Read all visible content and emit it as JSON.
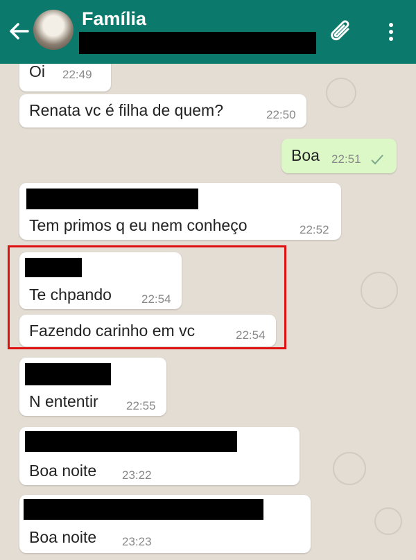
{
  "header": {
    "title": "Família"
  },
  "messages": [
    {
      "text": "Oi",
      "time": "22:49"
    },
    {
      "text": "Renata vc é filha de quem?",
      "time": "22:50"
    },
    {
      "text": "Boa",
      "time": "22:51"
    },
    {
      "text": "Tem primos q eu nem conheço",
      "time": "22:52"
    },
    {
      "text": "Te chpando",
      "time": "22:54"
    },
    {
      "text": "Fazendo carinho em vc",
      "time": "22:54"
    },
    {
      "text": "N ententir",
      "time": "22:55"
    },
    {
      "text": "Boa noite",
      "time": "23:22"
    },
    {
      "text": "Boa noite",
      "time": "23:23"
    }
  ],
  "colors": {
    "header": "#0b7a6c",
    "background": "#e4ddd4",
    "incoming_bubble": "#ffffff",
    "outgoing_bubble": "#dcf8c6",
    "highlight": "#e01010"
  },
  "icons": [
    "back-arrow-icon",
    "paperclip-icon",
    "more-vertical-icon",
    "double-check-icon"
  ]
}
